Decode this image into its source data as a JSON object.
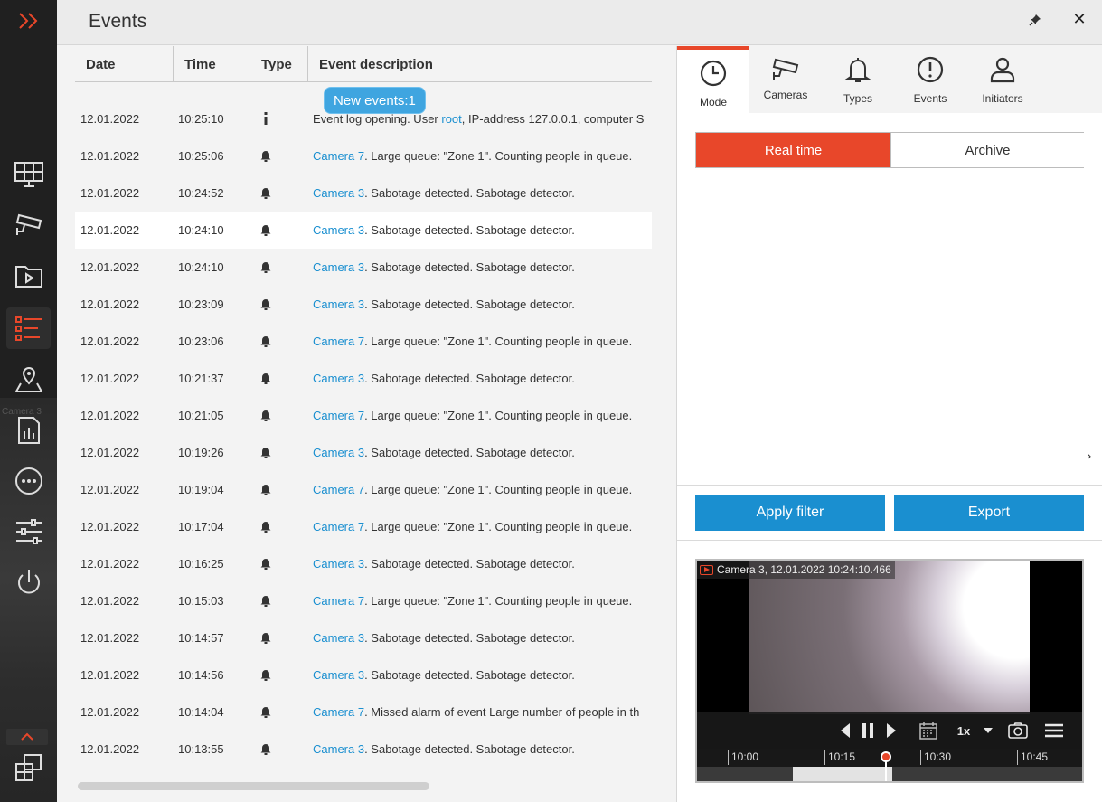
{
  "window": {
    "title": "Events",
    "pin_icon": "pin-icon",
    "close_label": "✕"
  },
  "sidebar": {
    "items": [
      {
        "name": "expand",
        "icon": "double-chevron-right-icon"
      },
      {
        "name": "monitoring",
        "icon": "monitor-grid-icon"
      },
      {
        "name": "cameras",
        "icon": "camera-icon"
      },
      {
        "name": "archive",
        "icon": "video-folder-icon"
      },
      {
        "name": "events",
        "icon": "event-list-icon",
        "active": true
      },
      {
        "name": "map",
        "icon": "map-pin-icon"
      },
      {
        "name": "reports",
        "icon": "report-icon"
      },
      {
        "name": "more",
        "icon": "more-icon"
      },
      {
        "name": "settings",
        "icon": "sliders-icon"
      },
      {
        "name": "power",
        "icon": "power-icon"
      }
    ],
    "background_label": "Camera 3"
  },
  "table": {
    "columns": [
      "Date",
      "Time",
      "Type",
      "Event description"
    ],
    "new_events_badge": "New events:1",
    "rows": [
      {
        "date": "12.01.2022",
        "time": "10:25:10",
        "type": "info",
        "link": "",
        "desc_pre": "Event log opening. User ",
        "desc_link": "root",
        "desc": ", IP-address 127.0.0.1, computer S"
      },
      {
        "date": "12.01.2022",
        "time": "10:25:06",
        "type": "bell",
        "link": "Camera 7",
        "desc": ". Large queue: \"Zone 1\". Counting people in queue."
      },
      {
        "date": "12.01.2022",
        "time": "10:24:52",
        "type": "bell",
        "link": "Camera 3",
        "desc": ". Sabotage detected. Sabotage detector."
      },
      {
        "date": "12.01.2022",
        "time": "10:24:10",
        "type": "bell",
        "link": "Camera 3",
        "desc": ". Sabotage detected. Sabotage detector.",
        "selected": true
      },
      {
        "date": "12.01.2022",
        "time": "10:24:10",
        "type": "bell",
        "link": "Camera 3",
        "desc": ". Sabotage detected. Sabotage detector."
      },
      {
        "date": "12.01.2022",
        "time": "10:23:09",
        "type": "bell",
        "link": "Camera 3",
        "desc": ". Sabotage detected. Sabotage detector."
      },
      {
        "date": "12.01.2022",
        "time": "10:23:06",
        "type": "bell",
        "link": "Camera 7",
        "desc": ". Large queue: \"Zone 1\". Counting people in queue."
      },
      {
        "date": "12.01.2022",
        "time": "10:21:37",
        "type": "bell",
        "link": "Camera 3",
        "desc": ". Sabotage detected. Sabotage detector."
      },
      {
        "date": "12.01.2022",
        "time": "10:21:05",
        "type": "bell",
        "link": "Camera 7",
        "desc": ". Large queue: \"Zone 1\". Counting people in queue."
      },
      {
        "date": "12.01.2022",
        "time": "10:19:26",
        "type": "bell",
        "link": "Camera 3",
        "desc": ". Sabotage detected. Sabotage detector."
      },
      {
        "date": "12.01.2022",
        "time": "10:19:04",
        "type": "bell",
        "link": "Camera 7",
        "desc": ". Large queue: \"Zone 1\". Counting people in queue."
      },
      {
        "date": "12.01.2022",
        "time": "10:17:04",
        "type": "bell",
        "link": "Camera 7",
        "desc": ". Large queue: \"Zone 1\". Counting people in queue."
      },
      {
        "date": "12.01.2022",
        "time": "10:16:25",
        "type": "bell",
        "link": "Camera 3",
        "desc": ". Sabotage detected. Sabotage detector."
      },
      {
        "date": "12.01.2022",
        "time": "10:15:03",
        "type": "bell",
        "link": "Camera 7",
        "desc": ". Large queue: \"Zone 1\". Counting people in queue."
      },
      {
        "date": "12.01.2022",
        "time": "10:14:57",
        "type": "bell",
        "link": "Camera 3",
        "desc": ". Sabotage detected. Sabotage detector."
      },
      {
        "date": "12.01.2022",
        "time": "10:14:56",
        "type": "bell",
        "link": "Camera 3",
        "desc": ". Sabotage detected. Sabotage detector."
      },
      {
        "date": "12.01.2022",
        "time": "10:14:04",
        "type": "bell",
        "link": "Camera 7",
        "desc": ". Missed alarm of event Large number of people in th"
      },
      {
        "date": "12.01.2022",
        "time": "10:13:55",
        "type": "bell",
        "link": "Camera 3",
        "desc": ". Sabotage detected. Sabotage detector."
      }
    ]
  },
  "filter": {
    "tabs": [
      {
        "label": "Mode",
        "icon": "clock-icon",
        "active": true
      },
      {
        "label": "Cameras",
        "icon": "camera-icon"
      },
      {
        "label": "Types",
        "icon": "bell-icon"
      },
      {
        "label": "Events",
        "icon": "alert-circle-icon"
      },
      {
        "label": "Initiators",
        "icon": "user-icon"
      }
    ],
    "mode_realtime": "Real time",
    "mode_archive": "Archive",
    "apply_label": "Apply filter",
    "export_label": "Export"
  },
  "player": {
    "caption": "Camera 3, 12.01.2022 10:24:10.466",
    "speed": "1x",
    "timeline_labels": [
      "10:00",
      "10:15",
      "10:30",
      "10:45"
    ]
  },
  "colors": {
    "accent": "#e8472a",
    "link": "#1a8fd0",
    "button": "#1a8fd0"
  }
}
